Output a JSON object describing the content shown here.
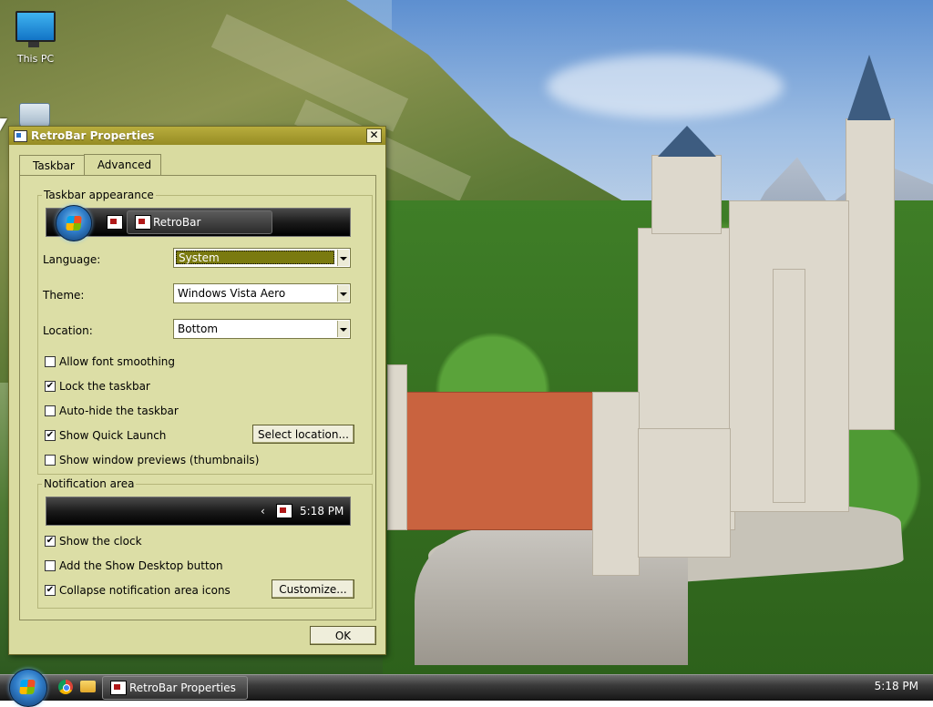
{
  "desktop": {
    "icons": [
      {
        "label": "This PC",
        "icon": "computer-icon"
      },
      {
        "label": "",
        "icon": "recycle-bin-icon"
      }
    ]
  },
  "window": {
    "title": "RetroBar Properties",
    "close_label": "✕",
    "tabs": [
      {
        "label": "Taskbar",
        "active": true
      },
      {
        "label": "Advanced",
        "active": false
      }
    ],
    "taskbar_appearance": {
      "group_label": "Taskbar appearance",
      "preview_task_label": "RetroBar",
      "language_label": "Language:",
      "language_value": "System",
      "theme_label": "Theme:",
      "theme_value": "Windows Vista Aero",
      "location_label": "Location:",
      "location_value": "Bottom",
      "options": [
        {
          "label": "Allow font smoothing",
          "checked": false
        },
        {
          "label": "Lock the taskbar",
          "checked": true
        },
        {
          "label": "Auto-hide the taskbar",
          "checked": false
        },
        {
          "label": "Show Quick Launch",
          "checked": true
        },
        {
          "label": "Show window previews (thumbnails)",
          "checked": false
        }
      ],
      "select_location_button": "Select location..."
    },
    "notification_area": {
      "group_label": "Notification area",
      "preview_chevron": "‹",
      "preview_clock": "5:18 PM",
      "options": [
        {
          "label": "Show the clock",
          "checked": true
        },
        {
          "label": "Add the Show Desktop button",
          "checked": false
        },
        {
          "label": "Collapse notification area icons",
          "checked": true
        }
      ],
      "customize_button": "Customize..."
    },
    "ok_button": "OK"
  },
  "taskbar": {
    "task_label": "RetroBar Properties",
    "clock": "5:18 PM",
    "quick_launch": [
      "chrome-icon",
      "folder-icon"
    ]
  },
  "colors": {
    "window_bg": "#d9dba0",
    "titlebar": "#a89e30",
    "selection": "#7a7a10"
  },
  "check_glyph": "✔"
}
